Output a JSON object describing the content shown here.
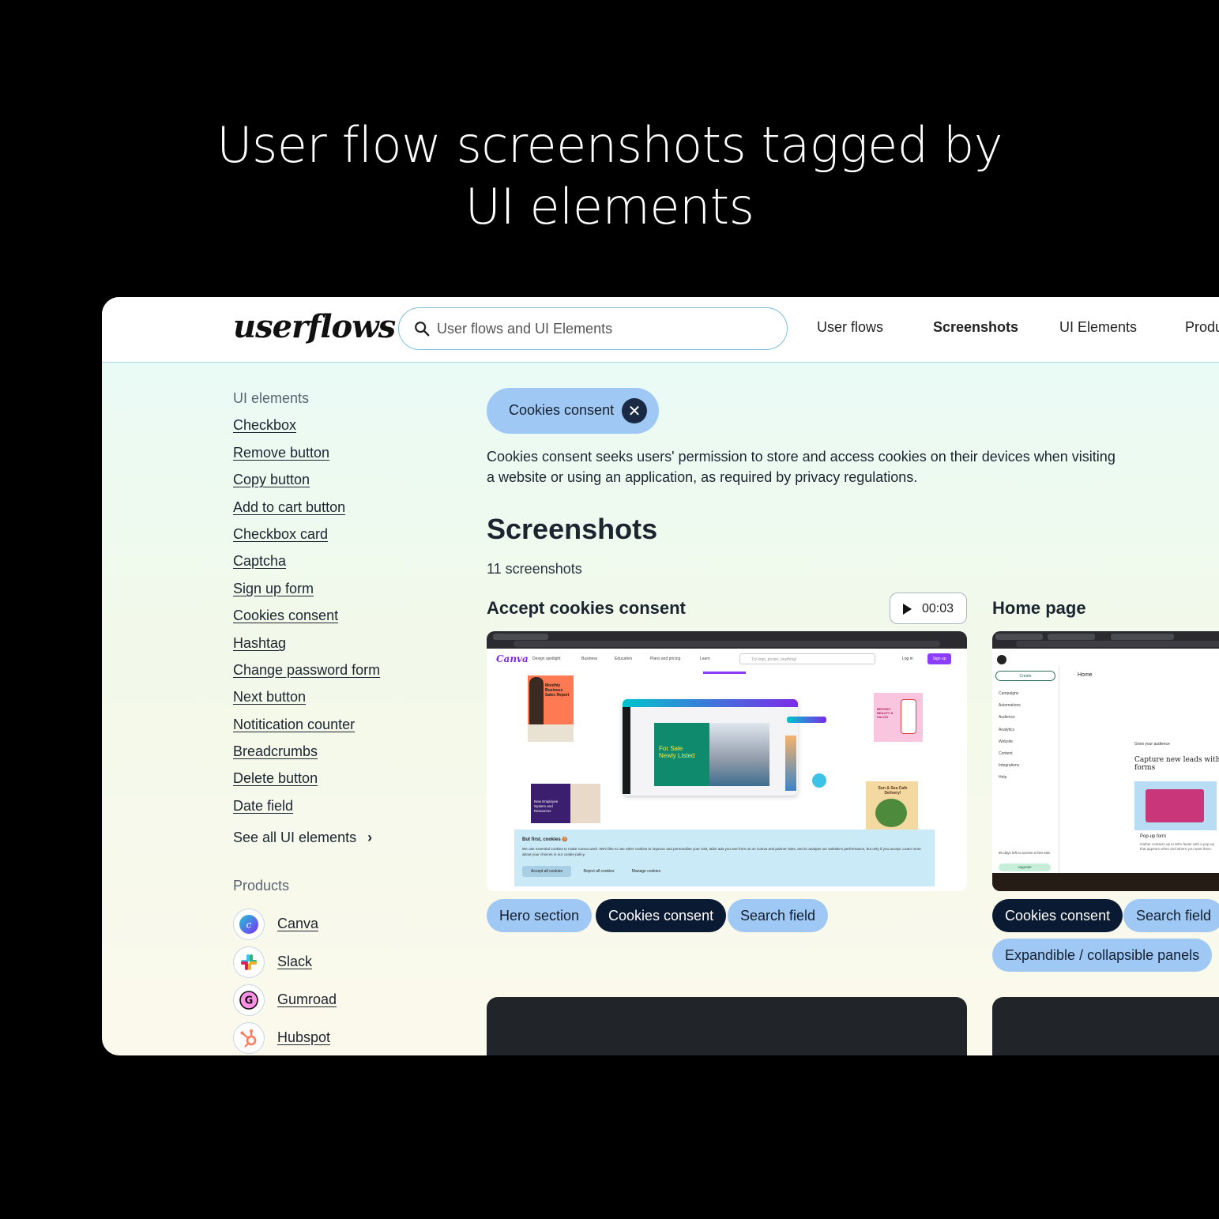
{
  "hero": {
    "line1": "User flow screenshots tagged by",
    "line2": "UI elements"
  },
  "header": {
    "logo": "userflows",
    "search_placeholder": "User flows and UI Elements",
    "nav": [
      "User flows",
      "Screenshots",
      "UI Elements",
      "Produ"
    ],
    "active_nav": "Screenshots"
  },
  "sidebar": {
    "ui_heading": "UI elements",
    "ui_links": [
      "Checkbox",
      "Remove button",
      "Copy button",
      "Add to cart button",
      "Checkbox card",
      "Captcha",
      "Sign up form",
      "Cookies consent",
      "Hashtag",
      "Change password form",
      "Next button",
      "Notitication counter",
      "Breadcrumbs",
      "Delete button",
      "Date field"
    ],
    "see_all": "See all UI elements",
    "products_heading": "Products",
    "products": [
      "Canva",
      "Slack",
      "Gumroad",
      "Hubspot"
    ]
  },
  "main": {
    "filter_chip": "Cookies consent",
    "description": "Cookies consent seeks users' permission to store and access cookies on their devices when visiting a website or using an application, as required by privacy regulations.",
    "section_title": "Screenshots",
    "count": "11 screenshots",
    "cards": [
      {
        "title": "Accept cookies consent",
        "duration": "00:03",
        "tags": [
          "Hero section",
          "Cookies consent",
          "Search field"
        ],
        "selected_tag": "Cookies consent",
        "shot": {
          "logo": "Canva",
          "nav": [
            "Design spotlight",
            "Business",
            "Education",
            "Plans and pricing",
            "Learn"
          ],
          "search_placeholder": "Try logo, poster, anything!",
          "login": "Log in",
          "signup": "Sign up",
          "report_title": "Monthly Business Sales Report",
          "listing_line1": "For Sale",
          "listing_line2": "Newly Listed",
          "employee_text": "New Employee System and Resources",
          "salon_text": "BRITNEY BEAUTY & SALON",
          "cafe_text": "Sun & Sea Cafe Delivery!",
          "cookie_title": "But first, cookies 🍪",
          "cookie_body": "We use essential cookies to make Canva work. We'd like to use other cookies to improve and personalise your visit, tailor ads you see from us on Canva and partner sites, and to analyse our website's performance, but only if you accept. Learn more about your choices in our cookie policy.",
          "accept": "Accept all cookies",
          "reject": "Reject all cookies",
          "manage": "Manage cookies"
        }
      },
      {
        "title": "Home page",
        "tags": [
          "Cookies consent",
          "Search field",
          "Expandible / collapsible panels"
        ],
        "selected_tag": "Cookies consent",
        "shot": {
          "create": "Create",
          "home": "Home",
          "menu": [
            "Campaigns",
            "Automations",
            "Audience",
            "Analytics",
            "Website",
            "Content",
            "Integrations",
            "Help"
          ],
          "grow": "Grow your audience",
          "capture": "Capture new leads with forms",
          "popup": "Pop-up form",
          "popup_desc": "Gather contacts up to 50% faster with a pop-up that appears when and where you want them.",
          "trial": "90 days left to access a free trial.",
          "upgrade": "Upgrade"
        }
      }
    ]
  },
  "colors": {
    "chip_light": "#9fc8f5",
    "chip_dark": "#0b1a33",
    "page_bg": "#000000"
  }
}
